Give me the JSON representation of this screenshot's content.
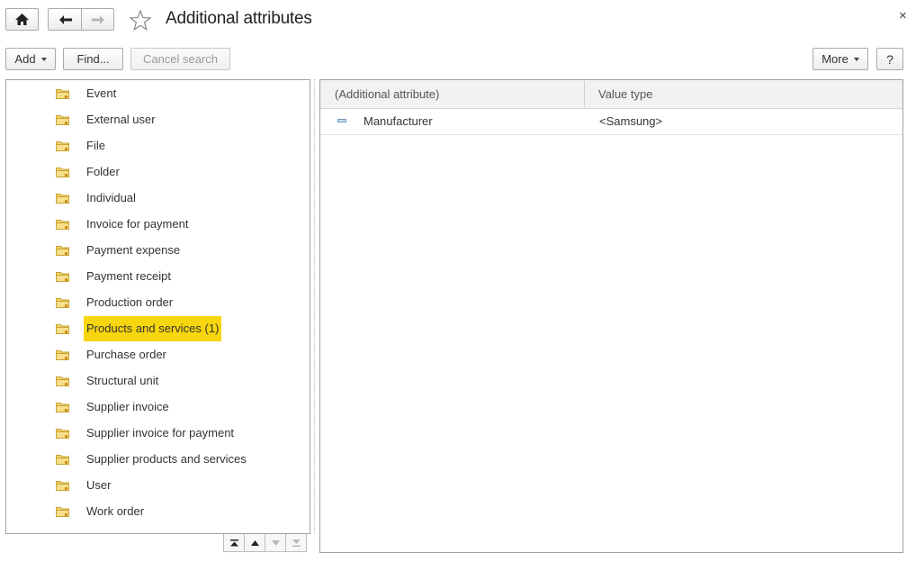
{
  "window": {
    "title": "Additional attributes",
    "close_glyph": "×"
  },
  "nav": {
    "home_icon": "home-icon",
    "back_icon": "arrow-left-icon",
    "forward_icon": "arrow-right-icon",
    "favorite_icon": "star-outline-icon"
  },
  "toolbar": {
    "add_label": "Add",
    "find_label": "Find...",
    "cancel_search_label": "Cancel search",
    "more_label": "More",
    "help_label": "?"
  },
  "tree": {
    "items": [
      {
        "label": "Event"
      },
      {
        "label": "External user"
      },
      {
        "label": "File"
      },
      {
        "label": "Folder"
      },
      {
        "label": "Individual"
      },
      {
        "label": "Invoice for payment"
      },
      {
        "label": "Payment expense"
      },
      {
        "label": "Payment receipt"
      },
      {
        "label": "Production order"
      },
      {
        "label": "Products and services (1)",
        "selected": true
      },
      {
        "label": "Purchase order"
      },
      {
        "label": "Structural unit"
      },
      {
        "label": "Supplier invoice"
      },
      {
        "label": "Supplier invoice for payment"
      },
      {
        "label": "Supplier products and services"
      },
      {
        "label": "User"
      },
      {
        "label": "Work order"
      }
    ],
    "selected_color": "#f8d60d"
  },
  "table": {
    "columns": [
      "(Additional attribute)",
      "Value type"
    ],
    "rows": [
      {
        "attribute": "Manufacturer",
        "value_type": "<Samsung>"
      }
    ]
  }
}
